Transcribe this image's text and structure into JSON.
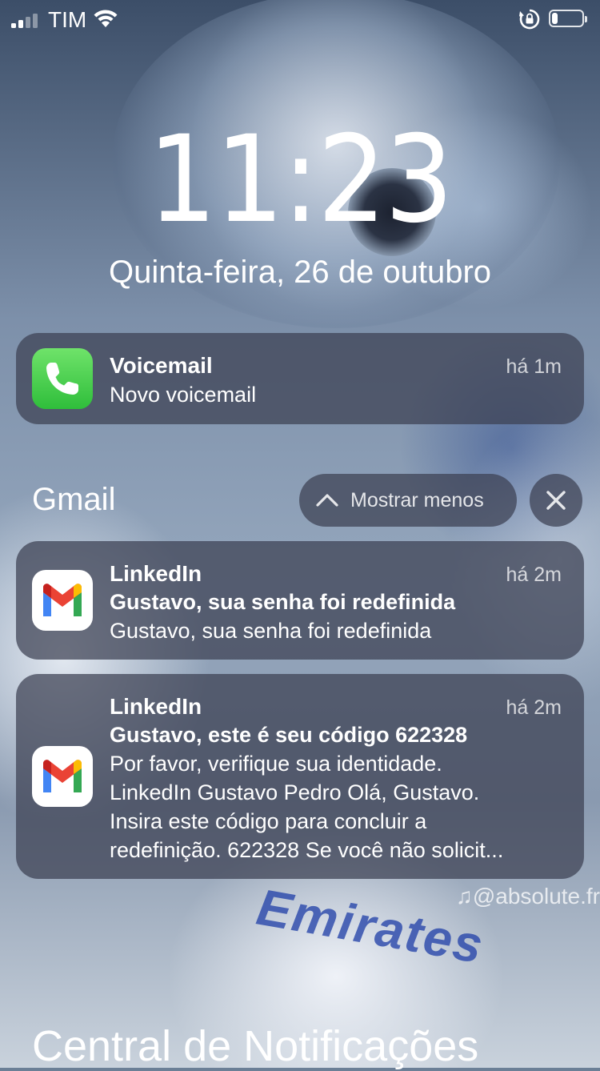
{
  "status_bar": {
    "carrier": "TIM",
    "signal_bars": 2,
    "battery_level": 0.2
  },
  "lock_screen": {
    "time": "11:23",
    "date": "Quinta-feira, 26 de outubro"
  },
  "notifications": {
    "voicemail": {
      "icon": "phone-icon",
      "title": "Voicemail",
      "time": "há 1m",
      "body": "Novo voicemail"
    },
    "gmail_group": {
      "group_name": "Gmail",
      "show_less_label": "Mostrar menos",
      "items": [
        {
          "icon": "gmail-icon",
          "title": "LinkedIn",
          "time": "há 2m",
          "subject": "Gustavo, sua senha foi redefinida",
          "body_lines": [
            "Gustavo, sua senha foi redefinida"
          ]
        },
        {
          "icon": "gmail-icon",
          "title": "LinkedIn",
          "time": "há 2m",
          "subject": "Gustavo, este é seu código 622328",
          "body_lines": [
            "Por favor, verifique sua identidade.",
            "LinkedIn Gustavo Pedro Olá, Gustavo.",
            "Insira este código para concluir a",
            "redefinição. 622328 Se você não solicit..."
          ]
        }
      ]
    }
  },
  "wallpaper": {
    "watermark": "@absolute.fr",
    "jersey_text": "Emirates"
  },
  "notification_center_title": "Central de Notificações"
}
